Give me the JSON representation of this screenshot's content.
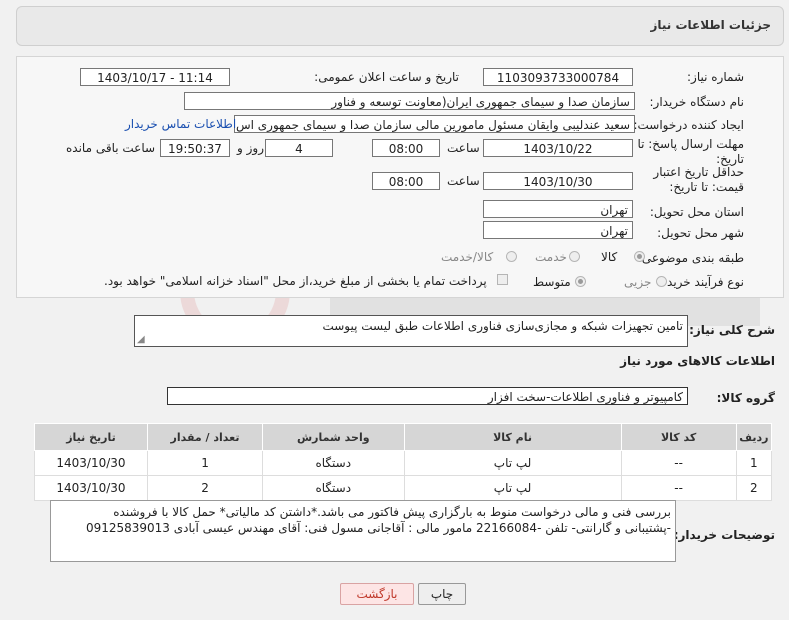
{
  "header": {
    "title": "جزئیات اطلاعات نیاز"
  },
  "form": {
    "need_number_label": "شماره نیاز:",
    "need_number": "1103093733000784",
    "announce_label": "تاریخ و ساعت اعلان عمومی:",
    "announce_value": "1403/10/17 - 11:14",
    "buyer_org_label": "نام دستگاه خریدار:",
    "buyer_org": "سازمان صدا و سیمای جمهوری ایران(معاونت توسعه و فناور",
    "creator_label": "ایجاد کننده درخواست:",
    "creator": "سعید عندلیبی وایقان مسئول مامورین مالی  سازمان صدا و سیمای جمهوری اس",
    "contact_link": "اطلاعات تماس خریدار",
    "reply_deadline_label": "مهلت ارسال پاسخ: تا تاریخ:",
    "reply_date": "1403/10/22",
    "time_label": "ساعت",
    "reply_time": "08:00",
    "days_value": "4",
    "days_label": "روز و",
    "remaining_time": "19:50:37",
    "remaining_label": "ساعت باقی مانده",
    "price_validity_label": "حداقل تاریخ اعتبار قیمت: تا تاریخ:",
    "validity_date": "1403/10/30",
    "validity_time": "08:00",
    "province_label": "استان محل تحویل:",
    "province": "تهران",
    "city_label": "شهر محل تحویل:",
    "city": "تهران",
    "category_label": "طبقه بندی موضوعی:",
    "category_options": [
      "کالا",
      "خدمت",
      "کالا/خدمت"
    ],
    "process_label": "نوع فرآیند خرید :",
    "process_options": [
      "جزیی",
      "متوسط"
    ],
    "payment_note": "پرداخت تمام یا بخشی از مبلغ خرید،از محل \"اسناد خزانه اسلامی\" خواهد بود."
  },
  "summary": {
    "label": "شرح کلی نیاز:",
    "text": "تامین تجهیزات شبکه و مجازی‌سازی فناوری اطلاعات طبق لیست پیوست"
  },
  "goods": {
    "section_title": "اطلاعات کالاهای مورد نیاز",
    "group_label": "گروه کالا:",
    "group_value": "کامپیوتر و فناوری اطلاعات-سخت افزار",
    "columns": [
      "ردیف",
      "کد کالا",
      "نام کالا",
      "واحد شمارش",
      "تعداد / مقدار",
      "تاریخ نیاز"
    ],
    "rows": [
      [
        "1",
        "--",
        "لپ تاپ",
        "دستگاه",
        "1",
        "1403/10/30"
      ],
      [
        "2",
        "--",
        "لپ تاپ",
        "دستگاه",
        "2",
        "1403/10/30"
      ]
    ]
  },
  "notes": {
    "label": "توضیحات خریدار:",
    "line1": "بررسی فنی و مالی درخواست منوط به بارگزاری پیش فاکتور می باشد.*داشتن کد مالیاتی*  حمل کالا با فروشنده",
    "line2": "-پشتیبانی و گارانتی- تلفن -22166084 مامور مالی : آقاجانی مسول فنی: آقای مهندس عیسی آبادی 09125839013"
  },
  "buttons": {
    "print": "چاپ",
    "back": "بازگشت"
  },
  "colors": {
    "back_text": "#c0392b",
    "link": "#1a4fb0"
  }
}
